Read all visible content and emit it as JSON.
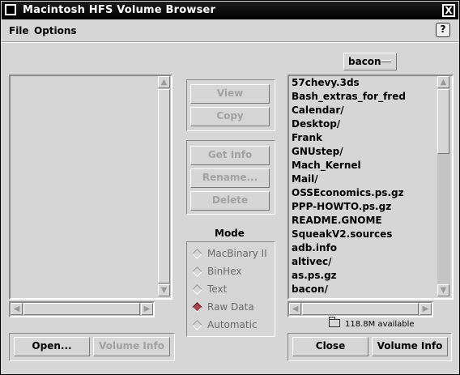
{
  "window": {
    "title": "Macintosh HFS Volume Browser",
    "close_glyph": "X"
  },
  "menu": {
    "file": "File",
    "options": "Options",
    "help_glyph": "?"
  },
  "volume_selector": {
    "value": "bacon"
  },
  "actions": {
    "view": "View",
    "copy": "Copy",
    "get_info": "Get Info",
    "rename": "Rename...",
    "delete": "Delete"
  },
  "mode": {
    "label": "Mode",
    "options": [
      "MacBinary II",
      "BinHex",
      "Text",
      "Raw Data",
      "Automatic"
    ],
    "selected": "Raw Data"
  },
  "left_panel": {
    "open": "Open...",
    "volume_info": "Volume Info"
  },
  "right_panel": {
    "files": [
      "57chevy.3ds",
      "Bash_extras_for_fred",
      "Calendar/",
      "Desktop/",
      "Frank",
      "GNUstep/",
      "Mach_Kernel",
      "Mail/",
      "OSSEconomics.ps.gz",
      "PPP-HOWTO.ps.gz",
      "README.GNOME",
      "SqueakV2.sources",
      "adb.info",
      "altivec/",
      "as.ps.gz",
      "bacon/"
    ],
    "available": "118.8M available",
    "close": "Close",
    "volume_info": "Volume Info"
  },
  "icons": [
    "window-menu-icon",
    "close-icon",
    "help-icon",
    "folder-icon",
    "arrow-up-icon",
    "arrow-down-icon",
    "arrow-left-icon",
    "arrow-right-icon"
  ]
}
